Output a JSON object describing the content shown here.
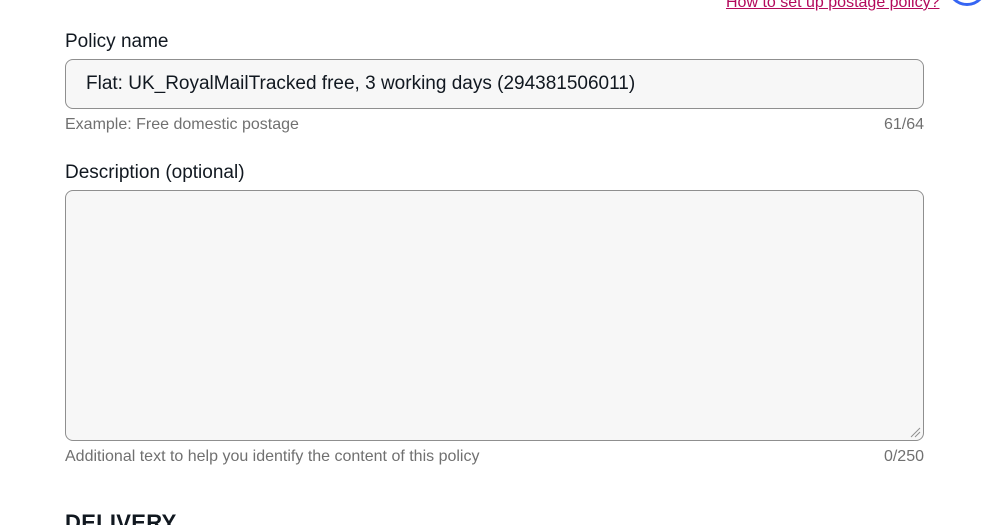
{
  "help": {
    "link_text": "How to set up postage policy?"
  },
  "policy_name": {
    "label": "Policy name",
    "value": "Flat: UK_RoyalMailTracked free, 3 working days (294381506011)",
    "hint": "Example: Free domestic postage",
    "counter": "61/64"
  },
  "description": {
    "label": "Description (optional)",
    "value": "",
    "hint": "Additional text to help you identify the content of this policy",
    "counter": "0/250"
  },
  "delivery": {
    "heading": "DELIVERY"
  },
  "colors": {
    "link": "#b3095c",
    "help_circle": "#3665f3",
    "field_bg": "#f7f7f7",
    "field_border": "#8f8f8f",
    "hint_text": "#707070"
  }
}
